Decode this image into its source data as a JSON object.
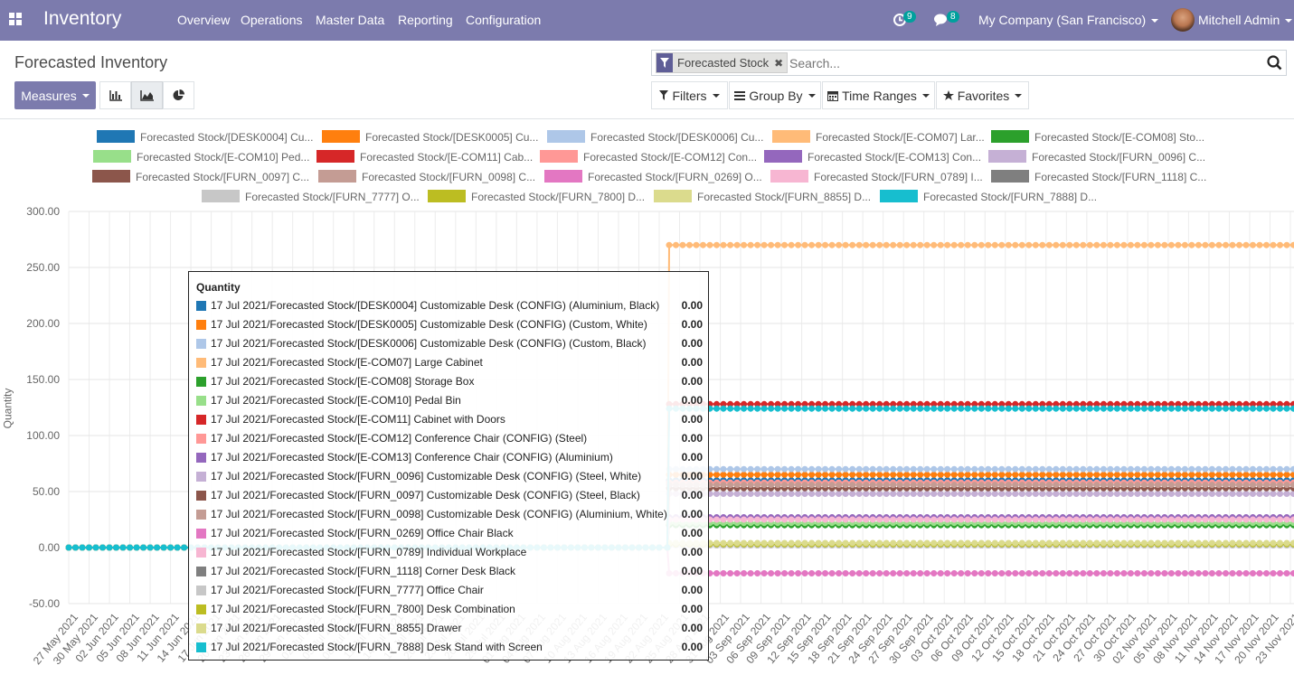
{
  "app": {
    "title": "Inventory"
  },
  "menu": {
    "items": [
      "Overview",
      "Operations",
      "Master Data",
      "Reporting",
      "Configuration"
    ]
  },
  "systray": {
    "activity_count": "9",
    "messages_count": "8",
    "company": "My Company (San Francisco)",
    "user": "Mitchell Admin"
  },
  "page": {
    "title": "Forecasted Inventory"
  },
  "search": {
    "facet": "Forecasted Stock",
    "placeholder": "Search..."
  },
  "buttons": {
    "measures": "Measures",
    "filters": "Filters",
    "group_by": "Group By",
    "time_ranges": "Time Ranges",
    "favorites": "Favorites"
  },
  "colors": {
    "topbar": "#7c7bad",
    "accent": "#00a09d"
  },
  "chart_data": {
    "type": "line",
    "ylabel": "Quantity",
    "ylim": [
      -50,
      300
    ],
    "yticks": [
      "300.00",
      "250.00",
      "200.00",
      "150.00",
      "100.00",
      "50.00",
      "0.00",
      "-50.00"
    ],
    "x_tick_labels": [
      "27 May 2021",
      "30 May 2021",
      "02 Jun 2021",
      "05 Jun 2021",
      "08 Jun 2021",
      "11 Jun 2021",
      "14 Jun 2021",
      "17 Jun 2021",
      "20 Jun 2021",
      "23 Jun 2021",
      "26 Jun 2021",
      "29 Jun 2021",
      "02 Jul 2021",
      "05 Jul 2021",
      "08 Jul 2021",
      "11 Jul 2021",
      "14 Jul 2021",
      "17 Jul 2021",
      "20 Jul 2021",
      "23 Jul 2021",
      "26 Jul 2021",
      "29 Jul 2021",
      "01 Aug 2021",
      "04 Aug 2021",
      "07 Aug 2021",
      "10 Aug 2021",
      "13 Aug 2021",
      "16 Aug 2021",
      "19 Aug 2021",
      "22 Aug 2021",
      "25 Aug 2021",
      "28 Aug 2021",
      "31 Aug 2021",
      "03 Sep 2021",
      "06 Sep 2021",
      "09 Sep 2021",
      "12 Sep 2021",
      "15 Sep 2021",
      "18 Sep 2021",
      "21 Sep 2021",
      "24 Sep 2021",
      "27 Sep 2021",
      "30 Sep 2021",
      "03 Oct 2021",
      "06 Oct 2021",
      "09 Oct 2021",
      "12 Oct 2021",
      "15 Oct 2021",
      "18 Oct 2021",
      "21 Oct 2021",
      "24 Oct 2021",
      "27 Oct 2021",
      "30 Oct 2021",
      "02 Nov 2021",
      "05 Nov 2021",
      "08 Nov 2021",
      "11 Nov 2021",
      "14 Nov 2021",
      "17 Nov 2021",
      "20 Nov 2021",
      "23 Nov 2021"
    ],
    "legend": [
      "Forecasted Stock/[DESK0004] Cu...",
      "Forecasted Stock/[DESK0005] Cu...",
      "Forecasted Stock/[DESK0006] Cu...",
      "Forecasted Stock/[E-COM07] Lar...",
      "Forecasted Stock/[E-COM08] Sto...",
      "Forecasted Stock/[E-COM10] Ped...",
      "Forecasted Stock/[E-COM11] Cab...",
      "Forecasted Stock/[E-COM12] Con...",
      "Forecasted Stock/[E-COM13] Con...",
      "Forecasted Stock/[FURN_0096] C...",
      "Forecasted Stock/[FURN_0097] C...",
      "Forecasted Stock/[FURN_0098] C...",
      "Forecasted Stock/[FURN_0269] O...",
      "Forecasted Stock/[FURN_0789] I...",
      "Forecasted Stock/[FURN_1118] C...",
      "Forecasted Stock/[FURN_7777] O...",
      "Forecasted Stock/[FURN_7800] D...",
      "Forecasted Stock/[FURN_8855] D...",
      "Forecasted Stock/[FURN_7888] D..."
    ],
    "series": [
      {
        "color": "#1f77b4",
        "before": 0,
        "after": 60
      },
      {
        "color": "#ff7f0e",
        "before": 0,
        "after": 65
      },
      {
        "color": "#aec7e8",
        "before": 0,
        "after": 70
      },
      {
        "color": "#ffbb78",
        "before": 0,
        "after": 270
      },
      {
        "color": "#2ca02c",
        "before": 0,
        "after": 20
      },
      {
        "color": "#98df8a",
        "before": 0,
        "after": 22
      },
      {
        "color": "#d62728",
        "before": 0,
        "after": 128
      },
      {
        "color": "#ff9896",
        "before": 0,
        "after": 58
      },
      {
        "color": "#9467bd",
        "before": 0,
        "after": 27
      },
      {
        "color": "#c5b0d5",
        "before": 0,
        "after": 48
      },
      {
        "color": "#8c564b",
        "before": 0,
        "after": 53
      },
      {
        "color": "#c49c94",
        "before": 0,
        "after": 56
      },
      {
        "color": "#e377c2",
        "before": 0,
        "after": -23
      },
      {
        "color": "#f7b6d2",
        "before": 0,
        "after": 25
      },
      {
        "color": "#7f7f7f",
        "before": 0,
        "after": 2
      },
      {
        "color": "#c7c7c7",
        "before": 0,
        "after": 2
      },
      {
        "color": "#bcbd22",
        "before": 0,
        "after": 3
      },
      {
        "color": "#dbdb8d",
        "before": 0,
        "after": 4
      },
      {
        "color": "#17becf",
        "before": 0,
        "after": 124
      }
    ]
  },
  "tooltip": {
    "title": "Quantity",
    "rows": [
      {
        "label": "17 Jul 2021/Forecasted Stock/[DESK0004] Customizable Desk (CONFIG) (Aluminium, Black)",
        "value": "0.00"
      },
      {
        "label": "17 Jul 2021/Forecasted Stock/[DESK0005] Customizable Desk (CONFIG) (Custom, White)",
        "value": "0.00"
      },
      {
        "label": "17 Jul 2021/Forecasted Stock/[DESK0006] Customizable Desk (CONFIG) (Custom, Black)",
        "value": "0.00"
      },
      {
        "label": "17 Jul 2021/Forecasted Stock/[E-COM07] Large Cabinet",
        "value": "0.00"
      },
      {
        "label": "17 Jul 2021/Forecasted Stock/[E-COM08] Storage Box",
        "value": "0.00"
      },
      {
        "label": "17 Jul 2021/Forecasted Stock/[E-COM10] Pedal Bin",
        "value": "0.00"
      },
      {
        "label": "17 Jul 2021/Forecasted Stock/[E-COM11] Cabinet with Doors",
        "value": "0.00"
      },
      {
        "label": "17 Jul 2021/Forecasted Stock/[E-COM12] Conference Chair (CONFIG) (Steel)",
        "value": "0.00"
      },
      {
        "label": "17 Jul 2021/Forecasted Stock/[E-COM13] Conference Chair (CONFIG) (Aluminium)",
        "value": "0.00"
      },
      {
        "label": "17 Jul 2021/Forecasted Stock/[FURN_0096] Customizable Desk (CONFIG) (Steel, White)",
        "value": "0.00"
      },
      {
        "label": "17 Jul 2021/Forecasted Stock/[FURN_0097] Customizable Desk (CONFIG) (Steel, Black)",
        "value": "0.00"
      },
      {
        "label": "17 Jul 2021/Forecasted Stock/[FURN_0098] Customizable Desk (CONFIG) (Aluminium, White)",
        "value": "0.00"
      },
      {
        "label": "17 Jul 2021/Forecasted Stock/[FURN_0269] Office Chair Black",
        "value": "0.00"
      },
      {
        "label": "17 Jul 2021/Forecasted Stock/[FURN_0789] Individual Workplace",
        "value": "0.00"
      },
      {
        "label": "17 Jul 2021/Forecasted Stock/[FURN_1118] Corner Desk Black",
        "value": "0.00"
      },
      {
        "label": "17 Jul 2021/Forecasted Stock/[FURN_7777] Office Chair",
        "value": "0.00"
      },
      {
        "label": "17 Jul 2021/Forecasted Stock/[FURN_7800] Desk Combination",
        "value": "0.00"
      },
      {
        "label": "17 Jul 2021/Forecasted Stock/[FURN_8855] Drawer",
        "value": "0.00"
      },
      {
        "label": "17 Jul 2021/Forecasted Stock/[FURN_7888] Desk Stand with Screen",
        "value": "0.00"
      }
    ]
  }
}
